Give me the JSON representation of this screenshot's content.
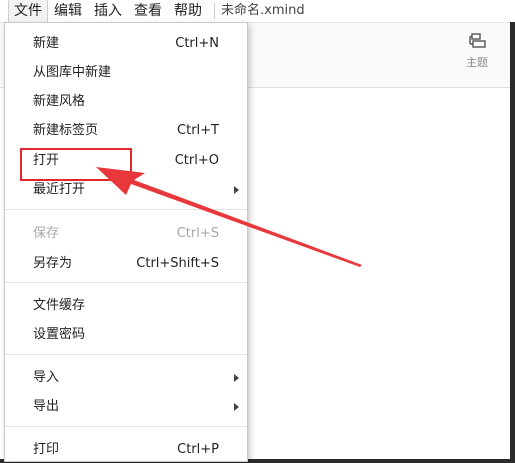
{
  "menubar": {
    "items": [
      {
        "label": "文件"
      },
      {
        "label": "编辑"
      },
      {
        "label": "插入"
      },
      {
        "label": "查看"
      },
      {
        "label": "帮助"
      }
    ],
    "document_title": "未命名.xmind"
  },
  "toolbar": {
    "theme_label": "主题",
    "theme_icon": "theme-icon"
  },
  "file_menu": {
    "groups": [
      [
        {
          "label": "新建",
          "shortcut": "Ctrl+N"
        },
        {
          "label": "从图库中新建",
          "shortcut": ""
        },
        {
          "label": "新建风格",
          "shortcut": ""
        },
        {
          "label": "新建标签页",
          "shortcut": "Ctrl+T"
        },
        {
          "label": "打开",
          "shortcut": "Ctrl+O"
        },
        {
          "label": "最近打开",
          "shortcut": "",
          "submenu": true
        }
      ],
      [
        {
          "label": "保存",
          "shortcut": "Ctrl+S",
          "disabled": true
        },
        {
          "label": "另存为",
          "shortcut": "Ctrl+Shift+S"
        }
      ],
      [
        {
          "label": "文件缓存",
          "shortcut": ""
        },
        {
          "label": "设置密码",
          "shortcut": ""
        }
      ],
      [
        {
          "label": "导入",
          "shortcut": "",
          "submenu": true
        },
        {
          "label": "导出",
          "shortcut": "",
          "submenu": true
        }
      ],
      [
        {
          "label": "打印",
          "shortcut": "Ctrl+P"
        }
      ]
    ]
  },
  "colors": {
    "annotation": "#e0282e",
    "disabled_text": "#a8a8a8",
    "menu_border": "#c9c9c9"
  }
}
